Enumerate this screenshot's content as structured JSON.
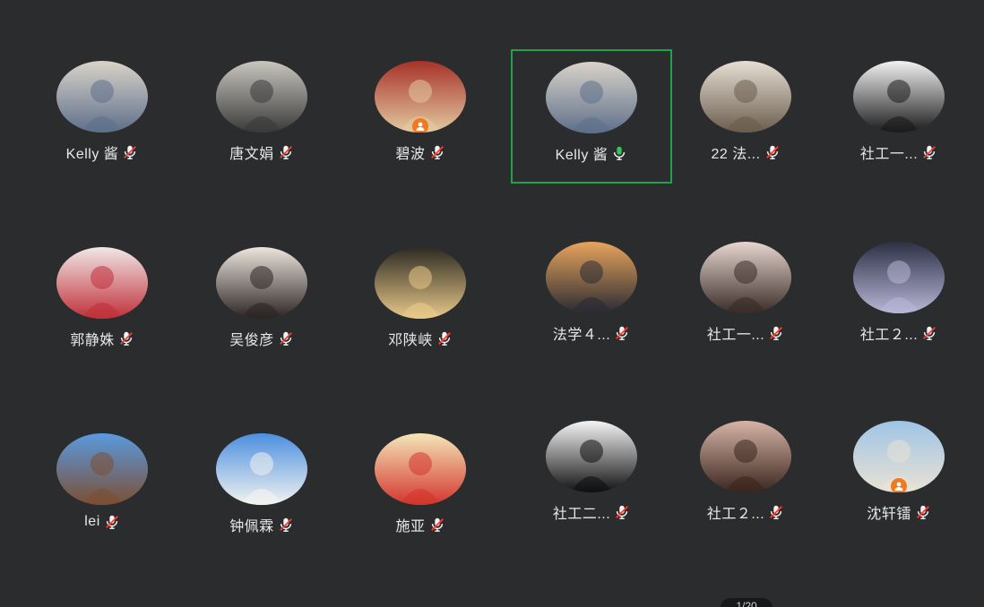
{
  "participants": [
    {
      "name": "Kelly 酱",
      "mic": "muted",
      "host": false,
      "active": false,
      "avatar_colors": [
        "#d9d3c9",
        "#5e6f8a"
      ]
    },
    {
      "name": "唐文娟",
      "mic": "muted",
      "host": false,
      "active": false,
      "avatar_colors": [
        "#c9c6bf",
        "#3a3a3a"
      ]
    },
    {
      "name": "碧波",
      "mic": "muted",
      "host": true,
      "active": false,
      "avatar_colors": [
        "#a6322a",
        "#e3c9a0"
      ]
    },
    {
      "name": "Kelly 酱",
      "mic": "on",
      "host": false,
      "active": true,
      "avatar_colors": [
        "#d9d3c9",
        "#5e6f8a"
      ]
    },
    {
      "name": "22 法...",
      "mic": "muted",
      "host": false,
      "active": false,
      "avatar_colors": [
        "#e6dfd3",
        "#6b5d4e"
      ]
    },
    {
      "name": "社工一...",
      "mic": "muted",
      "host": false,
      "active": false,
      "avatar_colors": [
        "#f2f2f2",
        "#1b1b1b"
      ]
    },
    {
      "name": "郭静姝",
      "mic": "muted",
      "host": false,
      "active": false,
      "avatar_colors": [
        "#f1e7e6",
        "#c0303a"
      ]
    },
    {
      "name": "吴俊彦",
      "mic": "muted",
      "host": false,
      "active": false,
      "avatar_colors": [
        "#ece5dc",
        "#2b2424"
      ]
    },
    {
      "name": "邓陕峡",
      "mic": "muted",
      "host": false,
      "active": false,
      "avatar_colors": [
        "#2c2a22",
        "#e9c98a"
      ]
    },
    {
      "name": "法学４...",
      "mic": "muted",
      "host": false,
      "active": false,
      "avatar_colors": [
        "#e8a45c",
        "#2a2b33"
      ]
    },
    {
      "name": "社工一...",
      "mic": "muted",
      "host": false,
      "active": false,
      "avatar_colors": [
        "#e7d6cf",
        "#3a2c28"
      ]
    },
    {
      "name": "社工２...",
      "mic": "muted",
      "host": false,
      "active": false,
      "avatar_colors": [
        "#2c2f45",
        "#b8b6d6"
      ]
    },
    {
      "name": "lei",
      "mic": "muted",
      "host": false,
      "active": false,
      "avatar_colors": [
        "#5a9adf",
        "#7b4f33"
      ]
    },
    {
      "name": "钟佩霖",
      "mic": "muted",
      "host": false,
      "active": false,
      "avatar_colors": [
        "#4b8fe0",
        "#f3f3f0"
      ]
    },
    {
      "name": "施亚",
      "mic": "muted",
      "host": false,
      "active": false,
      "avatar_colors": [
        "#f4e6b8",
        "#d4352d"
      ]
    },
    {
      "name": "社工二...",
      "mic": "muted",
      "host": false,
      "active": false,
      "avatar_colors": [
        "#f5f5f5",
        "#111111"
      ]
    },
    {
      "name": "社工２...",
      "mic": "muted",
      "host": false,
      "active": false,
      "avatar_colors": [
        "#d6b4a6",
        "#3b2620"
      ]
    },
    {
      "name": "沈轩镭",
      "mic": "muted",
      "host": true,
      "active": false,
      "avatar_colors": [
        "#9fc4e6",
        "#e9e2d4"
      ]
    }
  ],
  "pager": {
    "label": "1/20"
  },
  "colors": {
    "background": "#2b2c2e",
    "active_border": "#1fa24a",
    "mic_on": "#39c35a",
    "host_badge": "#f07a22"
  }
}
